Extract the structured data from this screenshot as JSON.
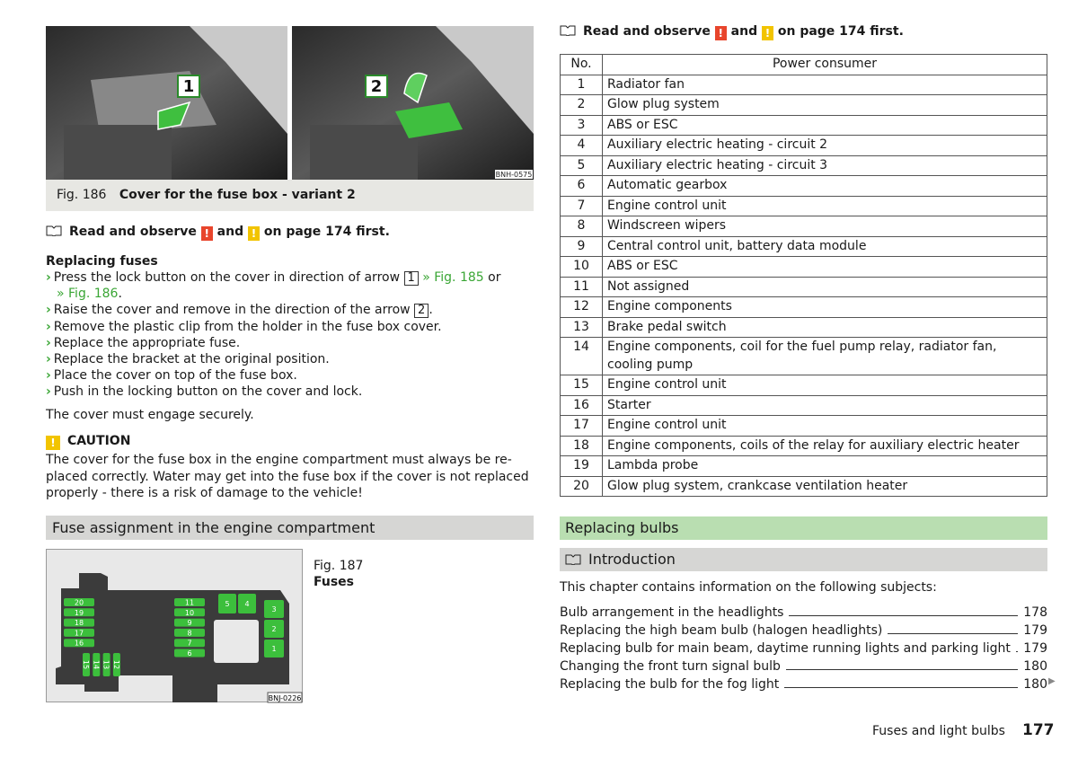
{
  "fig186": {
    "photo_code": "BNH-0575",
    "callout_1": "1",
    "callout_2": "2",
    "number": "Fig. 186",
    "title": "Cover for the fuse box - variant 2"
  },
  "left_notice": {
    "prefix": "Read and observe",
    "mark1": "!",
    "and": "and",
    "mark2": "!",
    "suffix": "on page 174 first."
  },
  "replacing_fuses": {
    "heading": "Replacing fuses",
    "steps": [
      {
        "pre": "Press the lock button on the cover in direction of arrow",
        "box": "1",
        "link": "» Fig. 185",
        "post": "or"
      },
      {
        "link": "» Fig. 186",
        "post": "."
      },
      {
        "pre": "Raise the cover and remove in the direction of the arrow",
        "box": "2",
        "post": "."
      },
      {
        "pre": "Remove the plastic clip from the holder in the fuse box cover."
      },
      {
        "pre": "Replace the appropriate fuse."
      },
      {
        "pre": "Replace the bracket at the original position."
      },
      {
        "pre": "Place the cover on top of the fuse box."
      },
      {
        "pre": "Push in the locking button on the cover and lock."
      }
    ],
    "note": "The cover must engage securely."
  },
  "caution": {
    "mark": "!",
    "title": "CAUTION",
    "lines": [
      "The cover for the fuse box in the engine compartment must always be re-",
      "placed correctly. Water may get into the fuse box if the cover is not replaced",
      "properly - there is a risk of damage to the vehicle!"
    ]
  },
  "section_fuse": "Fuse assignment in the engine compartment",
  "fig187": {
    "number": "Fig. 187",
    "title": "Fuses",
    "code": "BNJ-0226",
    "fuses_left": [
      "20",
      "19",
      "18",
      "17",
      "16"
    ],
    "fuses_mid": [
      "11",
      "10",
      "9",
      "8",
      "7",
      "6"
    ],
    "fuses_bottom": [
      "15",
      "14",
      "13",
      "12"
    ],
    "relays_top": [
      "5",
      "4"
    ],
    "relays_right": [
      "3",
      "2",
      "1"
    ]
  },
  "right_notice": {
    "prefix": "Read and observe",
    "mark1": "!",
    "and": "and",
    "mark2": "!",
    "suffix": "on page 174 first."
  },
  "table": {
    "headers": [
      "No.",
      "Power consumer"
    ],
    "rows": [
      [
        "1",
        "Radiator fan"
      ],
      [
        "2",
        "Glow plug system"
      ],
      [
        "3",
        "ABS or ESC"
      ],
      [
        "4",
        "Auxiliary electric heating - circuit 2"
      ],
      [
        "5",
        "Auxiliary electric heating - circuit 3"
      ],
      [
        "6",
        "Automatic gearbox"
      ],
      [
        "7",
        "Engine control unit"
      ],
      [
        "8",
        "Windscreen wipers"
      ],
      [
        "9",
        "Central control unit, battery data module"
      ],
      [
        "10",
        "ABS or ESC"
      ],
      [
        "11",
        "Not assigned"
      ],
      [
        "12",
        "Engine components"
      ],
      [
        "13",
        "Brake pedal switch"
      ],
      [
        "14",
        "Engine components, coil for the fuel pump relay, radiator fan, cooling pump"
      ],
      [
        "15",
        "Engine control unit"
      ],
      [
        "16",
        "Starter"
      ],
      [
        "17",
        "Engine control unit"
      ],
      [
        "18",
        "Engine components, coils of the relay for auxiliary electric heater"
      ],
      [
        "19",
        "Lambda probe"
      ],
      [
        "20",
        "Glow plug system, crankcase ventilation heater"
      ]
    ]
  },
  "section_bulbs": "Replacing bulbs",
  "intro": {
    "title": "Introduction",
    "lead": "This chapter contains information on the following subjects:",
    "toc": [
      {
        "label": "Bulb arrangement in the headlights",
        "page": "178"
      },
      {
        "label": "Replacing the high beam bulb (halogen headlights)",
        "page": "179"
      },
      {
        "label": "Replacing bulb for main beam, daytime running lights and parking light",
        "page": "179"
      },
      {
        "label": "Changing the front turn signal bulb",
        "page": "180"
      },
      {
        "label": "Replacing the bulb for the fog light",
        "page": "180"
      }
    ]
  },
  "footer": {
    "chapter": "Fuses and light bulbs",
    "page": "177"
  },
  "colors": {
    "accent_green": "#3aa635",
    "section_grey": "#d6d6d4",
    "section_green": "#b9deb1",
    "warning_red": "#e8452c",
    "warning_yellow": "#f2c400"
  }
}
